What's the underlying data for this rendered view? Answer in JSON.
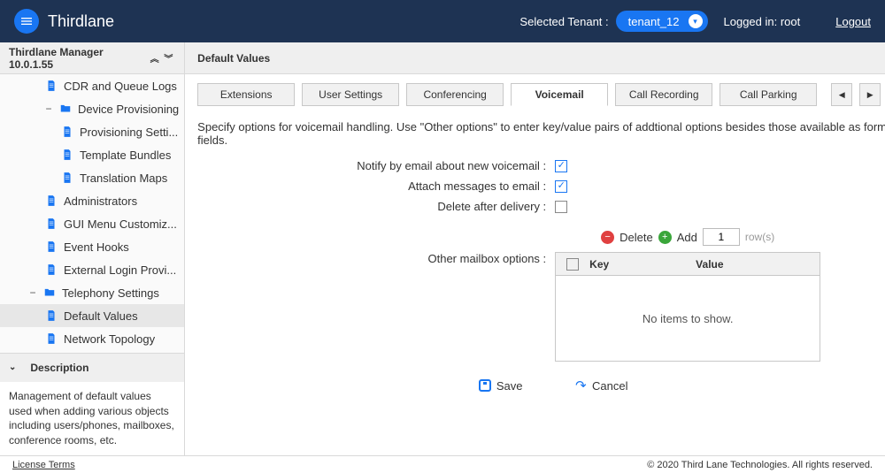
{
  "brand": "Thirdlane",
  "topbar": {
    "tenant_label": "Selected Tenant :",
    "tenant_value": "tenant_12",
    "logged_in_text": "Logged in: root",
    "logout": "Logout"
  },
  "sidebar": {
    "header": "Thirdlane Manager 10.0.1.55",
    "items": [
      {
        "label": "CDR and Queue Logs",
        "type": "page",
        "indent": "ti-indent1"
      },
      {
        "label": "Device Provisioning",
        "type": "folder",
        "indent": "ti-indent-parent2",
        "expanded": true
      },
      {
        "label": "Provisioning Setti...",
        "type": "page",
        "indent": "ti-indent2"
      },
      {
        "label": "Template Bundles",
        "type": "page",
        "indent": "ti-indent2"
      },
      {
        "label": "Translation Maps",
        "type": "page",
        "indent": "ti-indent2"
      },
      {
        "label": "Administrators",
        "type": "page",
        "indent": "ti-indent1"
      },
      {
        "label": "GUI Menu Customiz...",
        "type": "page",
        "indent": "ti-indent1"
      },
      {
        "label": "Event Hooks",
        "type": "page",
        "indent": "ti-indent1"
      },
      {
        "label": "External Login Provi...",
        "type": "page",
        "indent": "ti-indent1"
      },
      {
        "label": "Telephony Settings",
        "type": "folder",
        "indent": "ti-indent-parent1",
        "expanded": true
      },
      {
        "label": "Default Values",
        "type": "page",
        "indent": "ti-indent1",
        "selected": true
      },
      {
        "label": "Network Topology",
        "type": "page",
        "indent": "ti-indent1"
      }
    ],
    "desc_header": "Description",
    "desc_body": "Management of default values used when adding various objects including users/phones, mailboxes, conference rooms, etc."
  },
  "panel": {
    "title": "Default Values",
    "tabs": [
      "Extensions",
      "User Settings",
      "Conferencing",
      "Voicemail",
      "Call Recording",
      "Call Parking"
    ],
    "active_tab_index": 3,
    "hint": "Specify options for voicemail handling. Use \"Other options\" to enter key/value pairs of addtional options besides those available as form fields.",
    "fields": {
      "notify_label": "Notify by email about new voicemail :",
      "notify_checked": true,
      "attach_label": "Attach messages to email :",
      "attach_checked": true,
      "delete_label": "Delete after delivery :",
      "delete_checked": false,
      "other_label": "Other mailbox options :"
    },
    "actions": {
      "delete": "Delete",
      "add": "Add",
      "rows_value": "1",
      "rows_hint": "row(s)"
    },
    "kv": {
      "key_header": "Key",
      "value_header": "Value",
      "empty_text": "No items to show."
    },
    "buttons": {
      "save": "Save",
      "cancel": "Cancel"
    }
  },
  "footer": {
    "license": "License Terms",
    "copyright": "© 2020 Third Lane Technologies. All rights reserved."
  }
}
